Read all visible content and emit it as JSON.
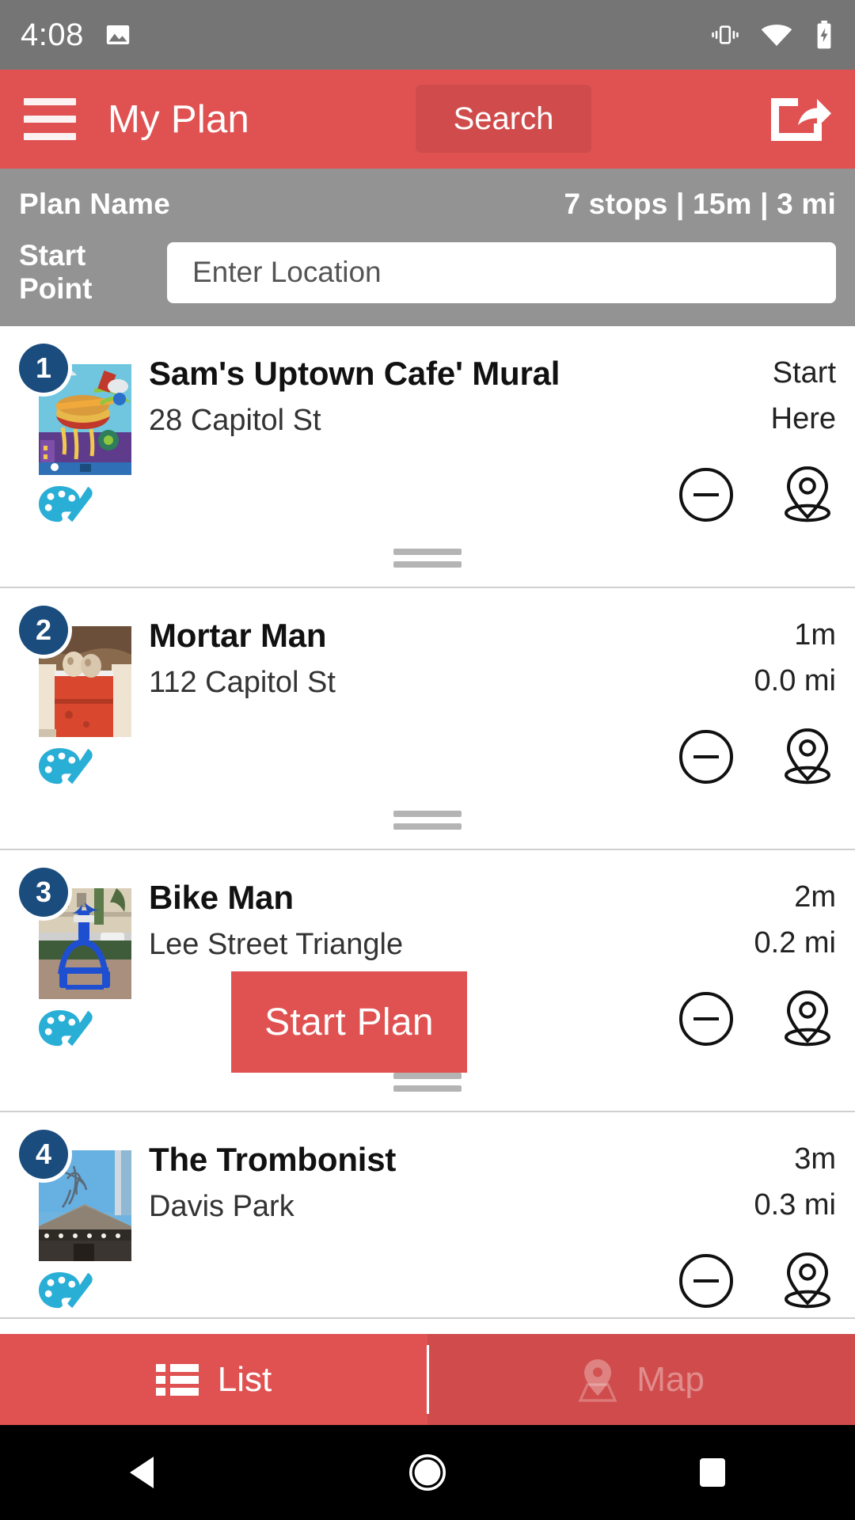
{
  "status_bar": {
    "time": "4:08",
    "icons": [
      "image-icon",
      "vibrate-icon",
      "wifi-icon",
      "battery-charging-icon"
    ],
    "background": "#757575"
  },
  "app_bar": {
    "menu_icon": "hamburger-menu-icon",
    "title": "My Plan",
    "search_label": "Search",
    "share_icon": "share-icon",
    "background": "#e05252"
  },
  "plan_panel": {
    "plan_name_label": "Plan Name",
    "stats": "7 stops | 15m | 3 mi",
    "stops_count": "7 stops",
    "duration": "15m",
    "distance": "3 mi",
    "start_point_label": "Start Point",
    "start_point_value": "",
    "start_point_placeholder": "Enter Location",
    "background": "#939393"
  },
  "stops": [
    {
      "number": "1",
      "title": "Sam's Uptown Cafe' Mural",
      "address": "28 Capitol St",
      "meta_primary": "Start",
      "meta_secondary": "Here",
      "category_icon": "palette-icon",
      "remove_icon": "minus-circle-icon",
      "locate_icon": "map-pin-icon",
      "thumbnail": "mural-colorful-thumbnail"
    },
    {
      "number": "2",
      "title": "Mortar Man",
      "address": "112 Capitol St",
      "meta_primary": "1m",
      "meta_secondary": "0.0 mi",
      "category_icon": "palette-icon",
      "remove_icon": "minus-circle-icon",
      "locate_icon": "map-pin-icon",
      "thumbnail": "mortar-man-thumbnail"
    },
    {
      "number": "3",
      "title": "Bike Man",
      "address": "Lee Street Triangle",
      "meta_primary": "2m",
      "meta_secondary": "0.2 mi",
      "category_icon": "palette-icon",
      "remove_icon": "minus-circle-icon",
      "locate_icon": "map-pin-icon",
      "thumbnail": "bike-man-blue-sculpture-thumbnail"
    },
    {
      "number": "4",
      "title": "The Trombonist",
      "address": "Davis Park",
      "meta_primary": "3m",
      "meta_secondary": "0.3 mi",
      "category_icon": "palette-icon",
      "remove_icon": "minus-circle-icon",
      "locate_icon": "map-pin-icon",
      "thumbnail": "trombonist-rooftop-thumbnail"
    }
  ],
  "start_plan_button": {
    "label": "Start Plan",
    "color": "#e05252"
  },
  "bottom_tabs": {
    "active": "List",
    "items": [
      {
        "label": "List",
        "icon": "list-icon",
        "active": true
      },
      {
        "label": "Map",
        "icon": "map-pin-icon",
        "active": false
      }
    ]
  },
  "android_nav": {
    "back_icon": "back-triangle-icon",
    "home_icon": "home-circle-icon",
    "recents_icon": "recents-square-icon"
  },
  "colors": {
    "accent_red": "#e05252",
    "panel_gray": "#939393",
    "status_gray": "#757575",
    "badge_blue": "#1b4c7e",
    "palette_cyan": "#29aed6"
  }
}
